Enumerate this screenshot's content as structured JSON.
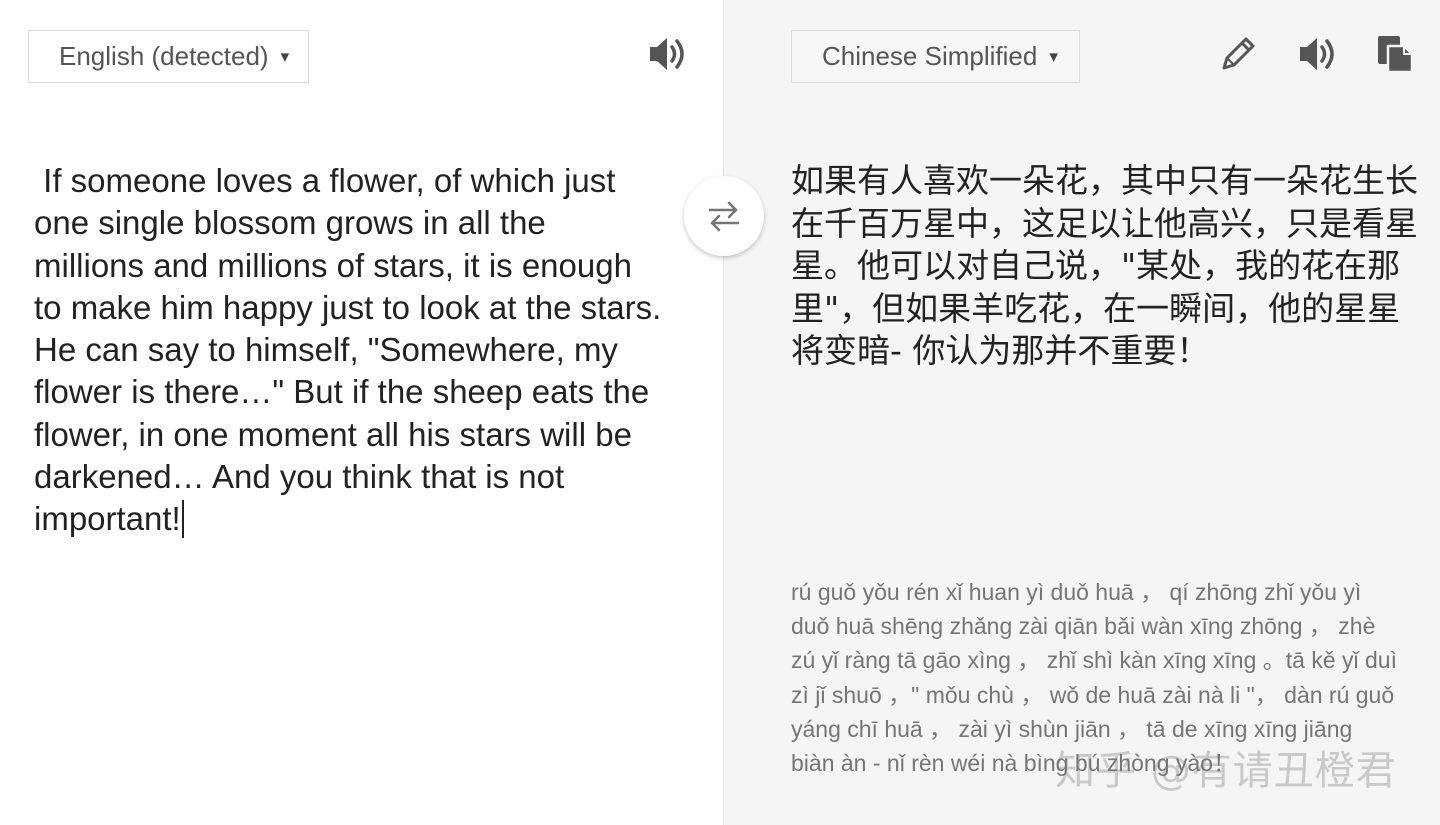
{
  "source": {
    "language_label": "English (detected)",
    "text": " If someone loves a flower, of which just one single blossom grows in all the millions and millions of stars, it is enough to make him happy just to look at the stars. He can say to himself, \"Somewhere, my flower is there…\" But if the sheep eats the flower, in one moment all his stars will be darkened… And you think that is not important!"
  },
  "target": {
    "language_label": "Chinese Simplified",
    "text": "如果有人喜欢一朵花，其中只有一朵花生长在千百万星中，这足以让他高兴，只是看星星。他可以对自己说，\"某处，我的花在那里\"，但如果羊吃花，在一瞬间，他的星星将变暗- 你认为那并不重要！",
    "pinyin": "rú guǒ yǒu rén xǐ huan yì duǒ huā ， qí zhōng zhǐ yǒu yì duǒ huā shēng zhǎng zài qiān bǎi wàn xīng zhōng ， zhè zú yǐ ràng tā gāo xìng ， zhǐ shì kàn xīng xīng 。tā kě yǐ duì zì jǐ shuō ，\" mǒu chù ， wǒ de huā zài nà li \"， dàn rú guǒ yáng chī huā ， zài yì shùn jiān ， tā de xīng xīng jiāng biàn àn - nǐ rèn wéi nà bìng bú zhòng yào！"
  },
  "watermark": "知乎 @有请丑橙君",
  "icons": {
    "caret": "▾",
    "source_speaker": "speaker-icon",
    "target_speaker": "speaker-icon",
    "edit": "pencil-icon",
    "copy": "copy-icon",
    "swap": "swap-arrows-icon"
  },
  "colors": {
    "left_bg": "#ffffff",
    "right_bg": "#f5f5f5",
    "text": "#222222",
    "pinyin": "#757575",
    "icon": "#555555"
  }
}
